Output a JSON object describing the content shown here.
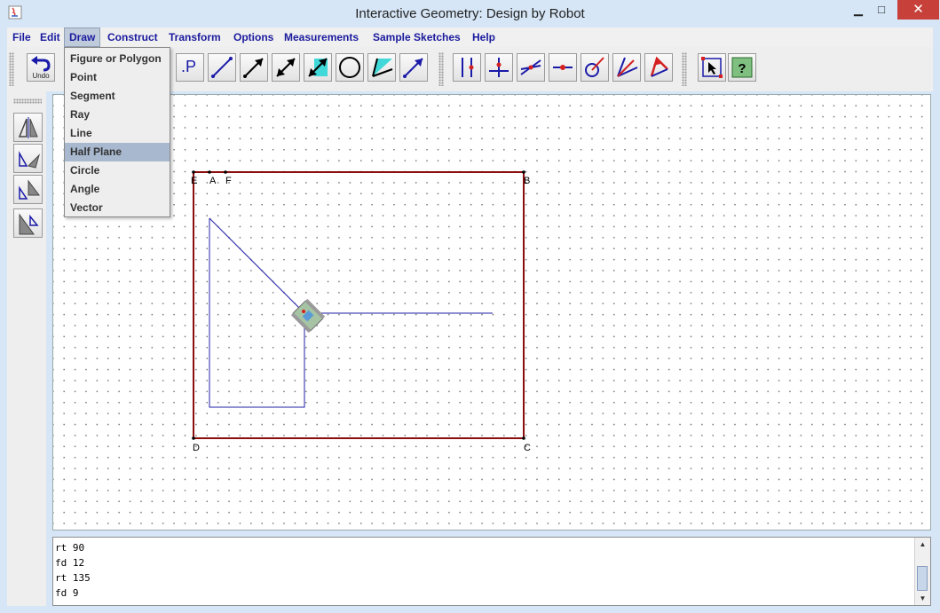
{
  "window": {
    "title": "Interactive Geometry: Design by Robot",
    "minimize": "▁",
    "maximize": "□",
    "close": "✕"
  },
  "menu": {
    "items": [
      {
        "label": "File"
      },
      {
        "label": "Edit"
      },
      {
        "label": "Draw"
      },
      {
        "label": "Construct"
      },
      {
        "label": "Transform"
      },
      {
        "label": "Options"
      },
      {
        "label": "Measurements"
      },
      {
        "label": "Sample Sketches"
      },
      {
        "label": "Help"
      }
    ],
    "active": "Draw"
  },
  "draw_menu": {
    "items": [
      {
        "label": "Figure or Polygon"
      },
      {
        "label": "Point"
      },
      {
        "label": "Segment"
      },
      {
        "label": "Ray"
      },
      {
        "label": "Line"
      },
      {
        "label": "Half Plane"
      },
      {
        "label": "Circle"
      },
      {
        "label": "Angle"
      },
      {
        "label": "Vector"
      }
    ],
    "highlighted": "Half Plane"
  },
  "toolbar": {
    "undo_label": "Undo",
    "point_label": ".P",
    "icons": [
      "undo-icon",
      "point-icon",
      "segment-icon",
      "ray-icon",
      "line-icon",
      "vector-icon",
      "circle-icon",
      "half-plane-icon",
      "vector-ray-icon",
      "parallel-icon",
      "perpendicular-icon",
      "intersect-icon",
      "midpoint-icon",
      "circle-construct-icon",
      "angle-bisector-icon",
      "vector-construct-icon",
      "select-tool-icon",
      "help-icon"
    ],
    "accent_colors": {
      "blue": "#1a1aa8",
      "red": "#d42020",
      "cyan": "#40d8d8"
    }
  },
  "sidebar": {
    "icons": [
      "reflect-icon",
      "rotate-icon",
      "dilate-icon",
      "translate-icon"
    ]
  },
  "canvas": {
    "point_labels": {
      "E": "E",
      "A": "A",
      "F": "F",
      "B": "B",
      "C": "C",
      "D": "D"
    },
    "rect_color": "#8b0d0d",
    "path_color": "#1f1fa8"
  },
  "console": {
    "lines": [
      "rt 90",
      "fd 12",
      "rt 135",
      "fd 9"
    ]
  }
}
